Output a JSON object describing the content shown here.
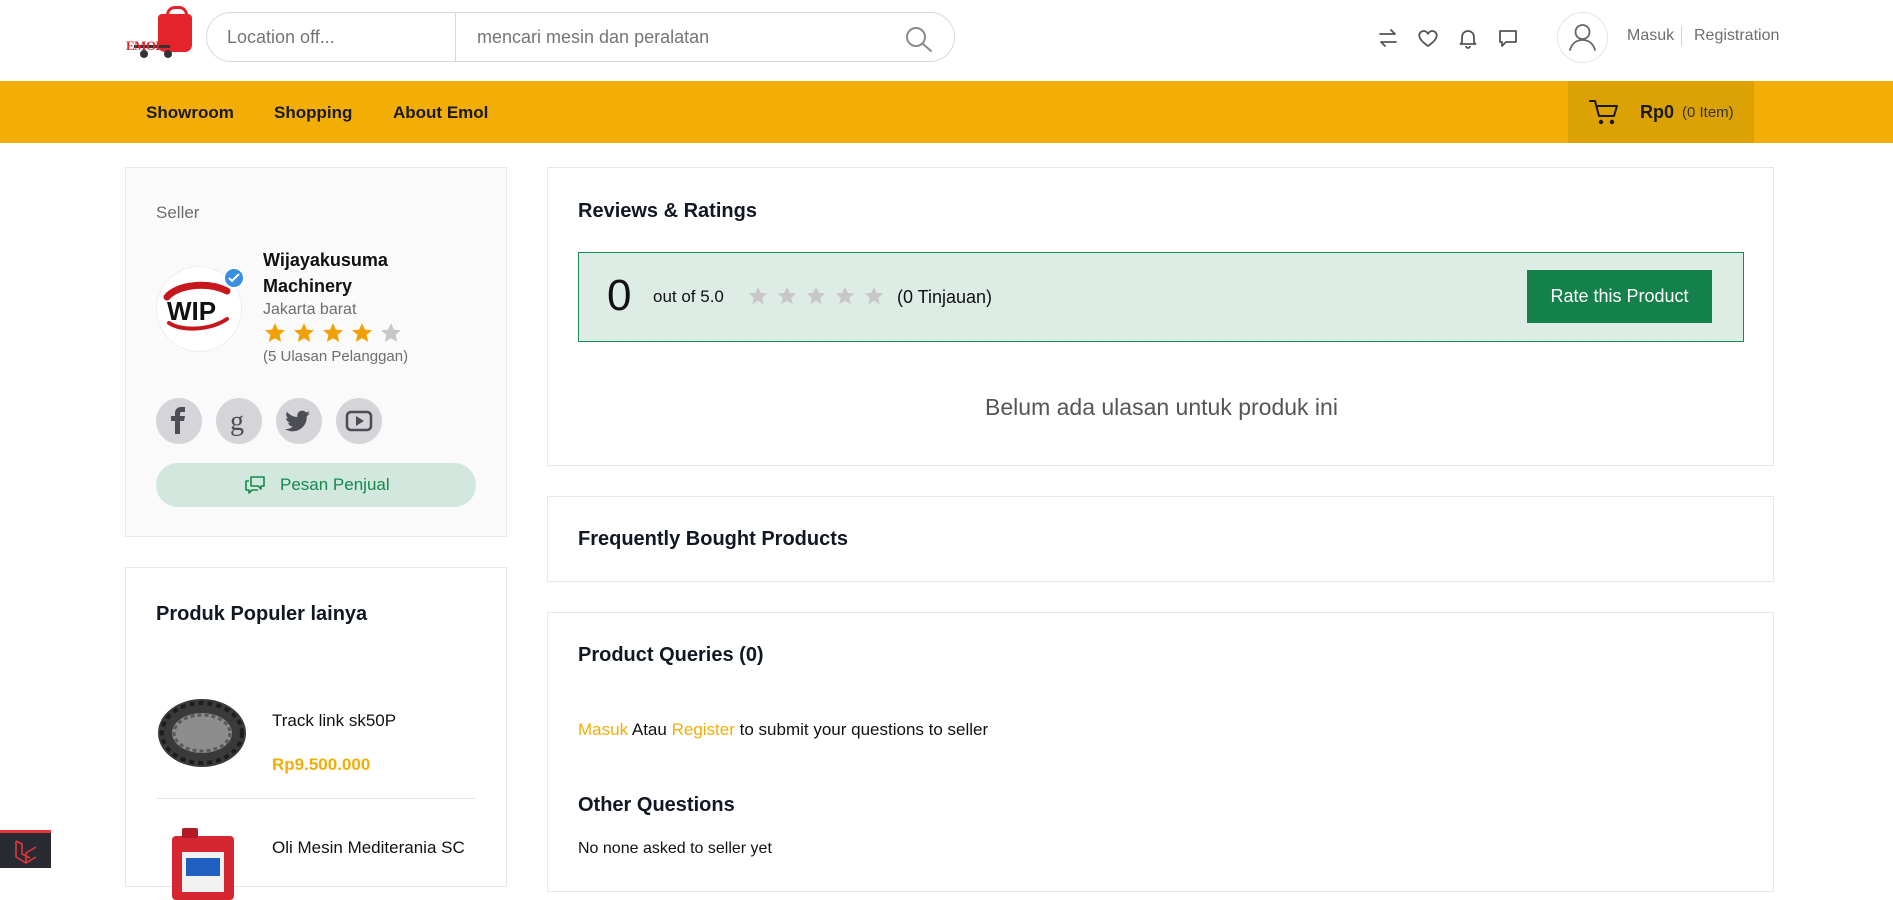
{
  "header": {
    "logo_text": "EMOL",
    "location_placeholder": "Location off...",
    "search_placeholder": "mencari mesin dan peralatan",
    "login": "Masuk",
    "register": "Registration"
  },
  "nav": {
    "links": [
      "Showroom",
      "Shopping",
      "About Emol"
    ],
    "cart_amount": "Rp0",
    "cart_count": "(0 Item)"
  },
  "seller": {
    "section_label": "Seller",
    "logo_text": "WIP",
    "name": "Wijayakusuma Machinery",
    "city": "Jakarta barat",
    "rating": 4,
    "rating_max": 5,
    "reviews": "(5 Ulasan Pelanggan)",
    "social": [
      "facebook",
      "google",
      "twitter",
      "youtube"
    ],
    "message_button": "Pesan Penjual"
  },
  "popular": {
    "title": "Produk Populer lainya",
    "items": [
      {
        "name": "Track link sk50P",
        "price": "Rp9.500.000"
      },
      {
        "name": "Oli Mesin Mediterania SC",
        "price": ""
      }
    ]
  },
  "reviews": {
    "title": "Reviews & Ratings",
    "score": "0",
    "out_of": "out of 5.0",
    "stars_filled": 0,
    "count_text": "(0 Tinjauan)",
    "rate_button": "Rate this Product",
    "empty_text": "Belum ada ulasan untuk produk ini"
  },
  "frequently": {
    "title": "Frequently Bought Products"
  },
  "queries": {
    "title": "Product Queries (0)",
    "login_link": "Masuk",
    "or_text": "Atau",
    "register_link": "Register",
    "suffix": "to submit your questions to seller",
    "other_title": "Other Questions",
    "none_asked": "No none asked to seller yet"
  },
  "colors": {
    "accent": "#f2ae07",
    "green": "#14804a",
    "green_light": "#ddece5"
  }
}
